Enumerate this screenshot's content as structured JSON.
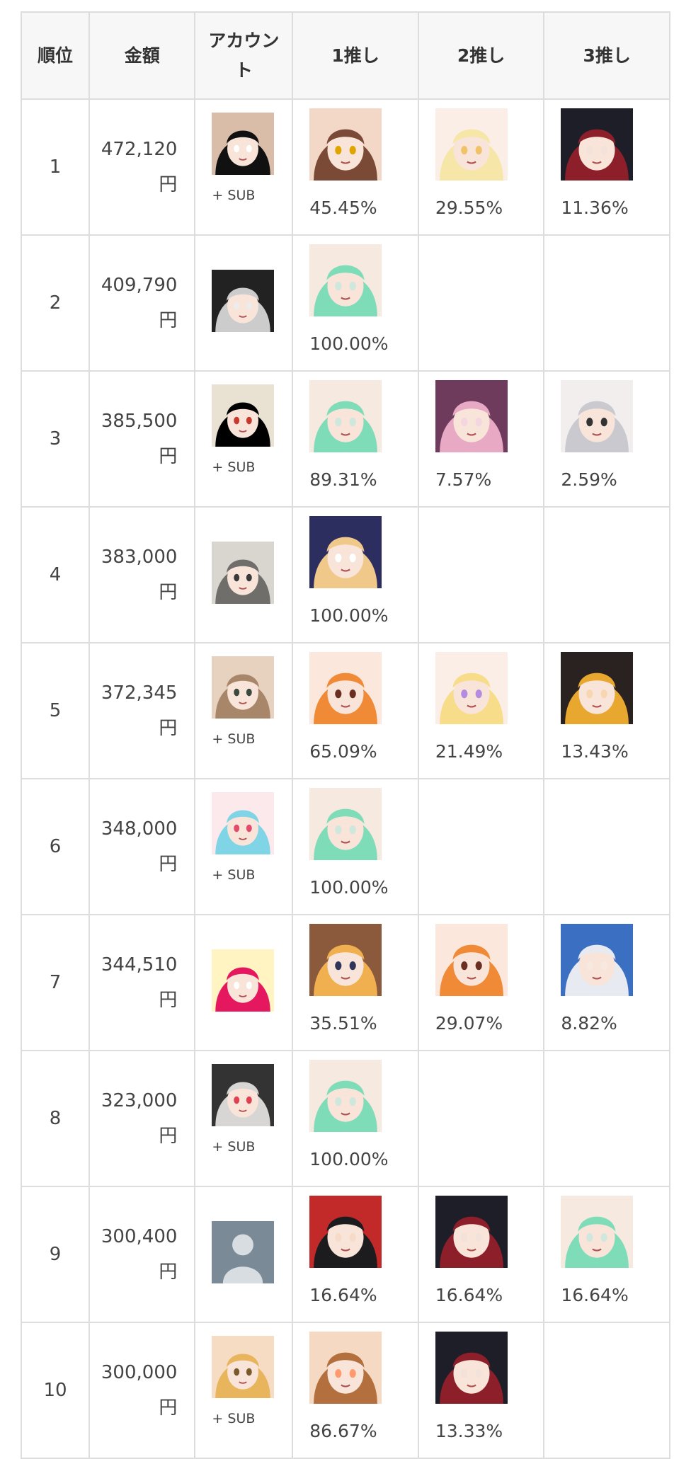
{
  "headers": {
    "rank": "順位",
    "amount": "金額",
    "account": "アカウント",
    "oshi1": "1推し",
    "oshi2": "2推し",
    "oshi3": "3推し"
  },
  "rows": [
    {
      "rank": "1",
      "amount": "472,120",
      "unit": "円",
      "sub": "+ SUB",
      "avatar": {
        "icon": "bald-man-bowtie-avatar",
        "colors": [
          "#111111",
          "#d9bda8",
          "#ffffff"
        ]
      },
      "oshi": [
        {
          "pct": "45.45%",
          "icon": "brown-hair-girl-portrait",
          "colors": [
            "#7a4a36",
            "#f3d8c8",
            "#e0a400"
          ]
        },
        {
          "pct": "29.55%",
          "icon": "blonde-sheep-girl-portrait",
          "colors": [
            "#f6e6a8",
            "#fbeee6",
            "#f0c26a"
          ]
        },
        {
          "pct": "11.36%",
          "icon": "pirate-girl-portrait",
          "colors": [
            "#8d1f2a",
            "#1e1e28",
            "#f3e2da"
          ]
        }
      ]
    },
    {
      "rank": "2",
      "amount": "409,790",
      "unit": "円",
      "sub": "",
      "avatar": {
        "icon": "hat-figure-avatar",
        "colors": [
          "#cccccc",
          "#222222",
          "#ececec"
        ]
      },
      "oshi": [
        {
          "pct": "100.00%",
          "icon": "green-hair-girl-portrait",
          "colors": [
            "#7fdcb9",
            "#f6e9e0",
            "#cfe7dc"
          ]
        }
      ]
    },
    {
      "rank": "3",
      "amount": "385,500",
      "unit": "円",
      "sub": "+ SUB",
      "avatar": {
        "icon": "sun-moon-emblem-avatar",
        "colors": [
          "#000000",
          "#e9e2d2",
          "#c8392e"
        ]
      },
      "oshi": [
        {
          "pct": "89.31%",
          "icon": "green-hair-girl-portrait",
          "colors": [
            "#7fdcb9",
            "#f6e9e0",
            "#cfe7dc"
          ]
        },
        {
          "pct": "7.57%",
          "icon": "pink-hair-girl-portrait",
          "colors": [
            "#e7a9c3",
            "#6e3b5c",
            "#f3d6df"
          ]
        },
        {
          "pct": "2.59%",
          "icon": "silver-hair-girl-portrait",
          "colors": [
            "#c9c9cf",
            "#f2eeee",
            "#333333"
          ]
        }
      ]
    },
    {
      "rank": "4",
      "amount": "383,000",
      "unit": "円",
      "sub": "",
      "avatar": {
        "icon": "wolf-avatar",
        "colors": [
          "#6f6e6b",
          "#d9d6cf",
          "#3a3a3a"
        ]
      },
      "oshi": [
        {
          "pct": "100.00%",
          "icon": "blonde-horn-girl-portrait",
          "colors": [
            "#f0c88a",
            "#2b2e5e",
            "#ffffff"
          ]
        }
      ]
    },
    {
      "rank": "5",
      "amount": "372,345",
      "unit": "円",
      "sub": "+ SUB",
      "avatar": {
        "icon": "cat-avatar",
        "colors": [
          "#a7866a",
          "#e6d2be",
          "#3b4a3e"
        ]
      },
      "oshi": [
        {
          "pct": "65.09%",
          "icon": "orange-hair-dragon-girl-portrait",
          "colors": [
            "#f08a36",
            "#fbe7dc",
            "#6a2f20"
          ]
        },
        {
          "pct": "21.49%",
          "icon": "blonde-twin-tail-girl-portrait",
          "colors": [
            "#f7dc8a",
            "#fbeee6",
            "#b58be0"
          ]
        },
        {
          "pct": "13.43%",
          "icon": "golden-hair-girl-portrait",
          "colors": [
            "#e8a82f",
            "#2a2220",
            "#f6d7b0"
          ]
        }
      ]
    },
    {
      "rank": "6",
      "amount": "348,000",
      "unit": "円",
      "sub": "+ SUB",
      "avatar": {
        "icon": "cyan-hair-winking-girl-avatar",
        "colors": [
          "#7fd4e6",
          "#fbe9ec",
          "#e24b6b"
        ]
      },
      "oshi": [
        {
          "pct": "100.00%",
          "icon": "green-hair-girl-portrait",
          "colors": [
            "#7fdcb9",
            "#f6e9e0",
            "#cfe7dc"
          ]
        }
      ]
    },
    {
      "rank": "7",
      "amount": "344,510",
      "unit": "円",
      "sub": "",
      "avatar": {
        "icon": "pink-logo-avatar",
        "colors": [
          "#e5175f",
          "#fff4c2",
          "#ffffff"
        ]
      },
      "oshi": [
        {
          "pct": "35.51%",
          "icon": "tan-girl-portrait",
          "colors": [
            "#f0b050",
            "#8b5a3c",
            "#30355c"
          ]
        },
        {
          "pct": "29.07%",
          "icon": "orange-hair-dragon-girl-portrait",
          "colors": [
            "#f08a36",
            "#fbe7dc",
            "#6a2f20"
          ]
        },
        {
          "pct": "8.82%",
          "icon": "white-hair-star-girl-portrait",
          "colors": [
            "#e8eaf2",
            "#3b6fc2",
            "#f6e9e0"
          ]
        }
      ]
    },
    {
      "rank": "8",
      "amount": "323,000",
      "unit": "円",
      "sub": "+ SUB",
      "avatar": {
        "icon": "gothic-doll-avatar",
        "colors": [
          "#d8d6d4",
          "#333333",
          "#e04050"
        ]
      },
      "oshi": [
        {
          "pct": "100.00%",
          "icon": "green-hair-girl-portrait",
          "colors": [
            "#7fdcb9",
            "#f6e9e0",
            "#cfe7dc"
          ]
        }
      ]
    },
    {
      "rank": "9",
      "amount": "300,400",
      "unit": "円",
      "sub": "",
      "avatar": {
        "icon": "default-user-avatar",
        "colors": [
          "#7a8a96",
          "#d8dde1"
        ]
      },
      "oshi": [
        {
          "pct": "16.64%",
          "icon": "black-hair-red-streak-girl-portrait",
          "colors": [
            "#1c1c1e",
            "#c22a2a",
            "#f6dcc8"
          ]
        },
        {
          "pct": "16.64%",
          "icon": "pirate-girl-portrait",
          "colors": [
            "#8d1f2a",
            "#1e1e28",
            "#f3e2da"
          ]
        },
        {
          "pct": "16.64%",
          "icon": "green-hair-girl-portrait",
          "colors": [
            "#7fdcb9",
            "#f6e9e0",
            "#cfe7dc"
          ]
        }
      ]
    },
    {
      "rank": "10",
      "amount": "300,000",
      "unit": "円",
      "sub": "+ SUB",
      "avatar": {
        "icon": "blonde-boy-avatar",
        "colors": [
          "#e8b45c",
          "#f7dcc4",
          "#7b5a2a"
        ]
      },
      "oshi": [
        {
          "pct": "86.67%",
          "icon": "brown-dog-girl-portrait",
          "colors": [
            "#b3703e",
            "#f6d9c2",
            "#ff9a70"
          ]
        },
        {
          "pct": "13.33%",
          "icon": "pirate-girl-portrait",
          "colors": [
            "#8d1f2a",
            "#1e1e28",
            "#f3e2da"
          ]
        }
      ]
    }
  ]
}
